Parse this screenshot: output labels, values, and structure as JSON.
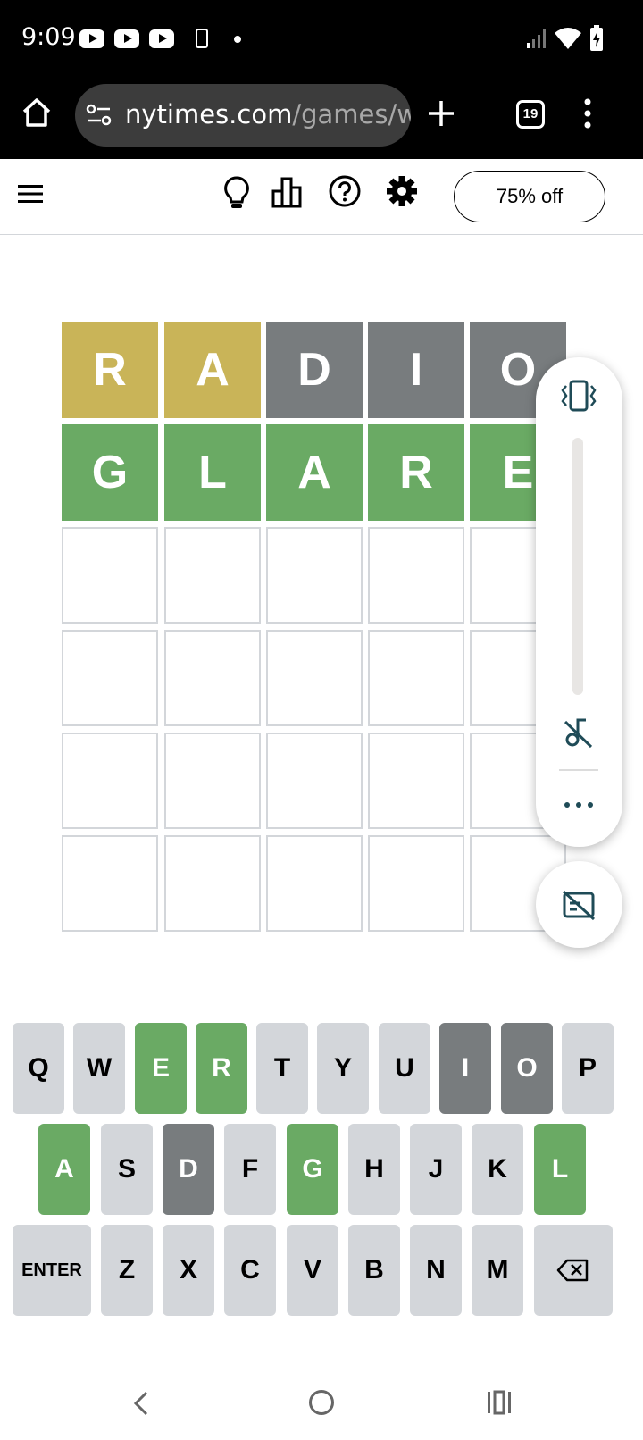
{
  "status_bar": {
    "time": "9:09",
    "notification_icons": [
      "youtube-icon",
      "youtube-icon",
      "youtube-icon",
      "phone-icon",
      "dot-icon"
    ],
    "system_icons": [
      "signal-icon",
      "wifi-icon",
      "battery-icon"
    ]
  },
  "browser": {
    "url_host": "nytimes.com",
    "url_path": "/games/wordle",
    "tabs_count": "19"
  },
  "header": {
    "promo_label": "75% off"
  },
  "board": {
    "rows": [
      [
        {
          "letter": "R",
          "state": "present"
        },
        {
          "letter": "A",
          "state": "present"
        },
        {
          "letter": "D",
          "state": "absent"
        },
        {
          "letter": "I",
          "state": "absent"
        },
        {
          "letter": "O",
          "state": "absent"
        }
      ],
      [
        {
          "letter": "G",
          "state": "correct"
        },
        {
          "letter": "L",
          "state": "correct"
        },
        {
          "letter": "A",
          "state": "correct"
        },
        {
          "letter": "R",
          "state": "correct"
        },
        {
          "letter": "E",
          "state": "correct"
        }
      ],
      [
        {
          "letter": "",
          "state": "empty"
        },
        {
          "letter": "",
          "state": "empty"
        },
        {
          "letter": "",
          "state": "empty"
        },
        {
          "letter": "",
          "state": "empty"
        },
        {
          "letter": "",
          "state": "empty"
        }
      ],
      [
        {
          "letter": "",
          "state": "empty"
        },
        {
          "letter": "",
          "state": "empty"
        },
        {
          "letter": "",
          "state": "empty"
        },
        {
          "letter": "",
          "state": "empty"
        },
        {
          "letter": "",
          "state": "empty"
        }
      ],
      [
        {
          "letter": "",
          "state": "empty"
        },
        {
          "letter": "",
          "state": "empty"
        },
        {
          "letter": "",
          "state": "empty"
        },
        {
          "letter": "",
          "state": "empty"
        },
        {
          "letter": "",
          "state": "empty"
        }
      ],
      [
        {
          "letter": "",
          "state": "empty"
        },
        {
          "letter": "",
          "state": "empty"
        },
        {
          "letter": "",
          "state": "empty"
        },
        {
          "letter": "",
          "state": "empty"
        },
        {
          "letter": "",
          "state": "empty"
        }
      ]
    ]
  },
  "keyboard": {
    "rows": [
      [
        {
          "label": "Q",
          "state": "unused"
        },
        {
          "label": "W",
          "state": "unused"
        },
        {
          "label": "E",
          "state": "correct"
        },
        {
          "label": "R",
          "state": "correct"
        },
        {
          "label": "T",
          "state": "unused"
        },
        {
          "label": "Y",
          "state": "unused"
        },
        {
          "label": "U",
          "state": "unused"
        },
        {
          "label": "I",
          "state": "absent"
        },
        {
          "label": "O",
          "state": "absent"
        },
        {
          "label": "P",
          "state": "unused"
        }
      ],
      [
        {
          "label": "A",
          "state": "correct"
        },
        {
          "label": "S",
          "state": "unused"
        },
        {
          "label": "D",
          "state": "absent"
        },
        {
          "label": "F",
          "state": "unused"
        },
        {
          "label": "G",
          "state": "correct"
        },
        {
          "label": "H",
          "state": "unused"
        },
        {
          "label": "J",
          "state": "unused"
        },
        {
          "label": "K",
          "state": "unused"
        },
        {
          "label": "L",
          "state": "correct"
        }
      ],
      [
        {
          "label": "ENTER",
          "state": "unused"
        },
        {
          "label": "Z",
          "state": "unused"
        },
        {
          "label": "X",
          "state": "unused"
        },
        {
          "label": "C",
          "state": "unused"
        },
        {
          "label": "V",
          "state": "unused"
        },
        {
          "label": "B",
          "state": "unused"
        },
        {
          "label": "N",
          "state": "unused"
        },
        {
          "label": "M",
          "state": "unused"
        },
        {
          "label": "",
          "icon": "backspace-icon",
          "state": "unused"
        }
      ]
    ]
  },
  "colors": {
    "correct": "#6aaa64",
    "present": "#c9b458",
    "absent": "#787c7e",
    "unused_key": "#d3d6da",
    "empty_border": "#d3d6da"
  }
}
